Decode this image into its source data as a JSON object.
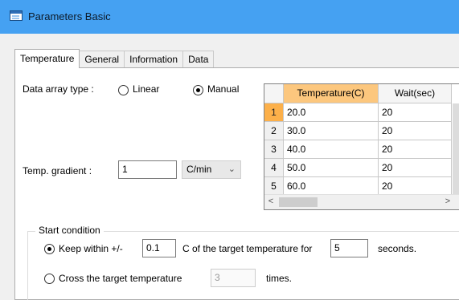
{
  "window": {
    "title": "Parameters Basic"
  },
  "tabs": [
    "Temperature",
    "General",
    "Information",
    "Data"
  ],
  "data_array": {
    "label": "Data array type :",
    "options": [
      {
        "label": "Linear",
        "checked": false
      },
      {
        "label": "Manual",
        "checked": true
      }
    ]
  },
  "gradient": {
    "label": "Temp. gradient :",
    "value": "1",
    "unit": "C/min"
  },
  "table": {
    "columns": [
      "Temperature(C)",
      "Wait(sec)"
    ],
    "rows": [
      {
        "index": "1",
        "temperature": "20.0",
        "wait": "20"
      },
      {
        "index": "2",
        "temperature": "30.0",
        "wait": "20"
      },
      {
        "index": "3",
        "temperature": "40.0",
        "wait": "20"
      },
      {
        "index": "4",
        "temperature": "50.0",
        "wait": "20"
      },
      {
        "index": "5",
        "temperature": "60.0",
        "wait": "20"
      }
    ],
    "selected_row": "1"
  },
  "start_condition": {
    "title": "Start condition",
    "keep": {
      "label": "Keep within +/-",
      "value": "0.1",
      "mid_text": "C of the target temperature for",
      "seconds_value": "5",
      "suffix": "seconds.",
      "checked": true
    },
    "cross": {
      "label": "Cross the target temperature",
      "value": "3",
      "suffix": "times.",
      "checked": false
    }
  },
  "colors": {
    "titlebar": "#45a1f2",
    "selected_header": "#fcc77e",
    "selected_row_header": "#fcb04a"
  }
}
